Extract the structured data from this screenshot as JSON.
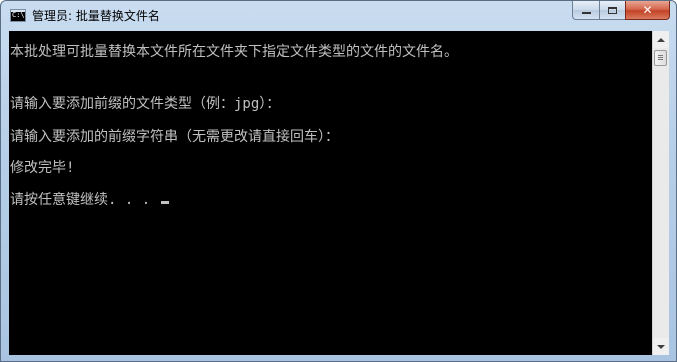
{
  "window": {
    "title": "管理员:  批量替换文件名",
    "icon": "cmd-icon",
    "icon_text": "C:\\.",
    "buttons": {
      "minimize": "minimize-icon",
      "maximize": "maximize-icon",
      "close": "close-icon",
      "close_label": "✕"
    }
  },
  "console": {
    "lines": [
      "本批处理可批量替换本文件所在文件夹下指定文件类型的文件的文件名。",
      "请输入要添加前缀的文件类型（例：jpg）：",
      "请输入要添加的前缀字符串（无需更改请直接回车）：",
      "修改完毕!",
      "请按任意键继续. . . "
    ],
    "text_color": "#c0c0c0",
    "background_color": "#000000"
  },
  "scrollbar": {
    "up_arrow": "scroll-up-icon",
    "down_arrow": "scroll-down-icon"
  }
}
